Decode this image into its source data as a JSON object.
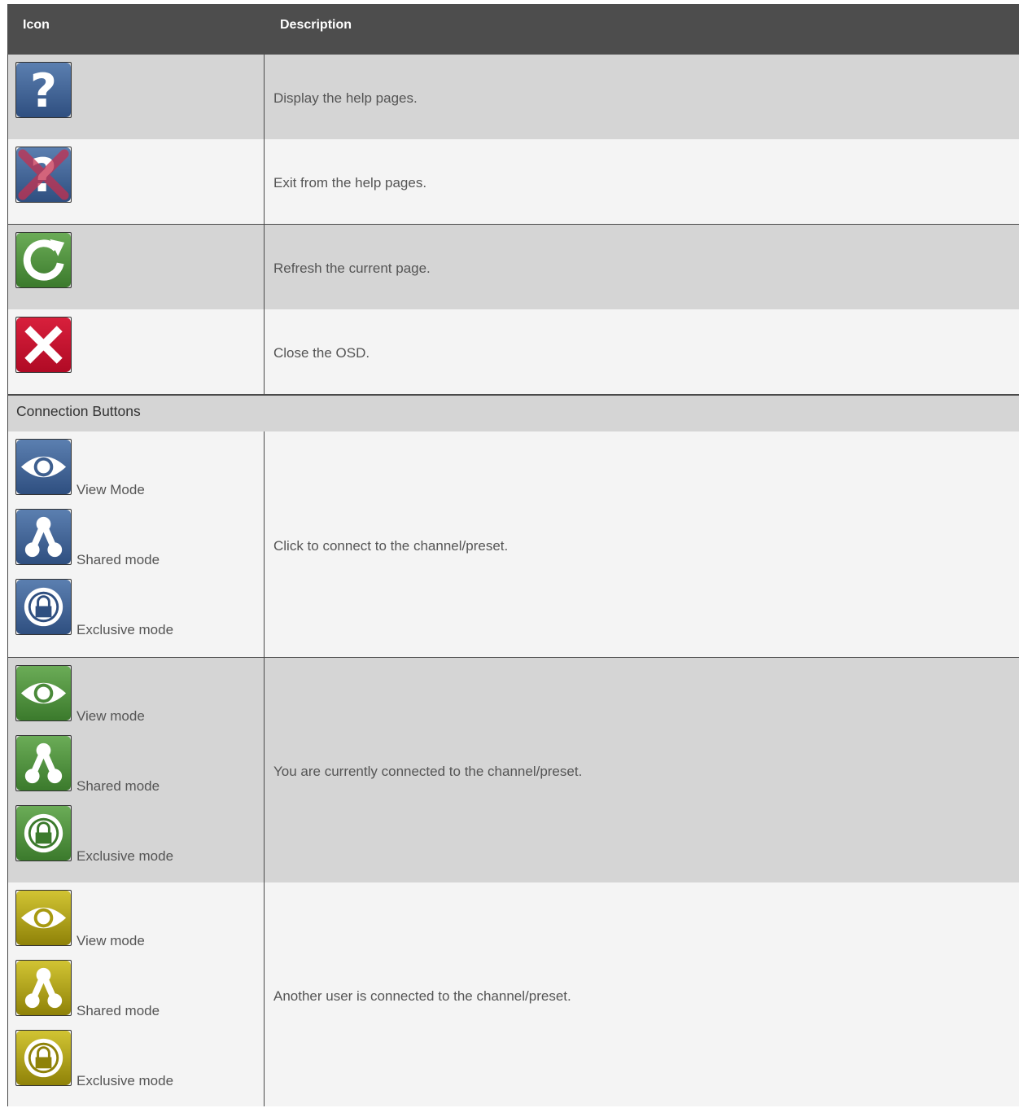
{
  "header": {
    "icon_col": "Icon",
    "desc_col": "Description"
  },
  "rows": [
    {
      "icon": "help-icon",
      "description": "Display the help pages."
    },
    {
      "icon": "exit-help-icon",
      "description": "Exit from the help pages."
    },
    {
      "icon": "refresh-icon",
      "description": "Refresh the current page."
    },
    {
      "icon": "close-icon",
      "description": "Close the OSD."
    }
  ],
  "section_title": "Connection Buttons",
  "connection_groups": [
    {
      "color": "#3e5f8f",
      "modes": [
        {
          "icon": "eye-icon",
          "label": "View Mode"
        },
        {
          "icon": "shared-icon",
          "label": "Shared mode"
        },
        {
          "icon": "lock-icon",
          "label": "Exclusive mode"
        }
      ],
      "description": "Click to connect to the channel/preset."
    },
    {
      "color": "#4a8a3a",
      "modes": [
        {
          "icon": "eye-icon",
          "label": "View mode"
        },
        {
          "icon": "shared-icon",
          "label": "Shared mode"
        },
        {
          "icon": "lock-icon",
          "label": "Exclusive mode"
        }
      ],
      "description": "You are currently connected to the channel/preset."
    },
    {
      "color": "#a89a10",
      "modes": [
        {
          "icon": "eye-icon",
          "label": "View mode"
        },
        {
          "icon": "shared-icon",
          "label": "Shared mode"
        },
        {
          "icon": "lock-icon",
          "label": "Exclusive mode"
        }
      ],
      "description": "Another user is connected to the channel/preset."
    }
  ],
  "colors": {
    "header_bg": "#4d4d4d",
    "row_gray": "#d5d5d5",
    "row_light": "#f4f4f4",
    "blue": "#3e5f8f",
    "green": "#4a8a3a",
    "red": "#c8102e",
    "yellow": "#a89a10"
  }
}
